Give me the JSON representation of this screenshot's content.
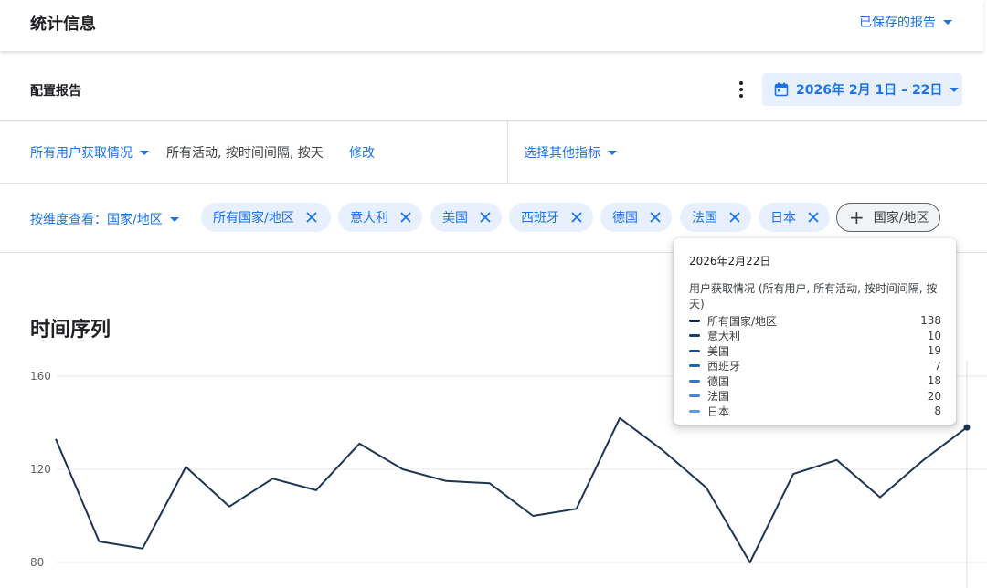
{
  "header": {
    "title": "统计信息",
    "saved_reports": "已保存的报告"
  },
  "config": {
    "label": "配置报告",
    "date_range": "2026年 2月 1日 – 22日"
  },
  "metric": {
    "select": "所有用户获取情况",
    "description": "所有活动, 按时间间隔, 按天",
    "modify": "修改",
    "other": "选择其他指标"
  },
  "dimension": {
    "label": "按维度查看：国家/地区",
    "chips": [
      "所有国家/地区",
      "意大利",
      "美国",
      "西班牙",
      "德国",
      "法国",
      "日本"
    ],
    "add_label": "国家/地区"
  },
  "section_title": "时间序列",
  "tooltip": {
    "date": "2026年2月22日",
    "metric": "用户获取情况 (所有用户, 所有活动, 按时间间隔, 按天)",
    "rows": [
      {
        "name": "所有国家/地区",
        "value": "138",
        "color": "#0d2a4a"
      },
      {
        "name": "意大利",
        "value": "10",
        "color": "#173f6e"
      },
      {
        "name": "美国",
        "value": "19",
        "color": "#1f5190"
      },
      {
        "name": "西班牙",
        "value": "7",
        "color": "#2a64ad"
      },
      {
        "name": "德国",
        "value": "18",
        "color": "#3776c4"
      },
      {
        "name": "法国",
        "value": "20",
        "color": "#4688d6"
      },
      {
        "name": "日本",
        "value": "8",
        "color": "#5a9be6"
      }
    ]
  },
  "colors": {
    "accent": "#1a73e8",
    "chip_bg": "#e8f0fe",
    "line": "#1c3553"
  },
  "chart_data": {
    "type": "line",
    "x": [
      1,
      2,
      3,
      4,
      5,
      6,
      7,
      8,
      9,
      10,
      11,
      12,
      13,
      14,
      15,
      16,
      17,
      18,
      19,
      20,
      21,
      22
    ],
    "series": [
      {
        "name": "所有国家/地区",
        "values": [
          133,
          89,
          86,
          121,
          104,
          116,
          111,
          131,
          120,
          115,
          114,
          100,
          103,
          142,
          128,
          112,
          80,
          118,
          124,
          108,
          124,
          138
        ]
      }
    ],
    "ylim": [
      70,
      165
    ],
    "yticks": [
      160,
      120,
      80
    ],
    "grid": true
  }
}
